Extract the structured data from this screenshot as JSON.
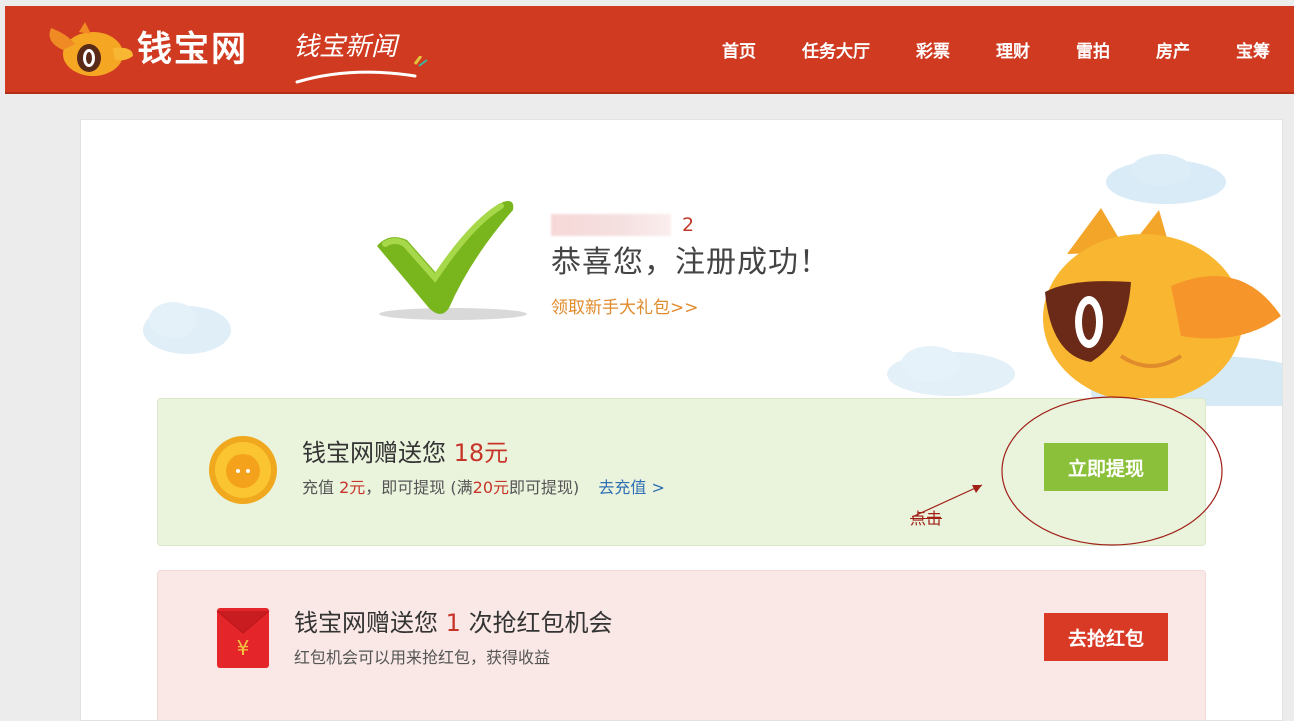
{
  "header": {
    "brand": "钱宝网",
    "news_brand": "钱宝新闻",
    "nav": [
      "首页",
      "任务大厅",
      "彩票",
      "理财",
      "雷拍",
      "房产",
      "宝筹"
    ],
    "bg_color": "#cf3a20"
  },
  "success": {
    "phone_suffix": "2",
    "message": "恭喜您，注册成功！",
    "gift_link": "领取新手大礼包>>"
  },
  "reward": {
    "title_prefix": "钱宝网赠送您",
    "amount": "18元",
    "sub_1": "充值",
    "sub_amount": "2元",
    "sub_2": "，即可提现 (满",
    "sub_threshold": "20元",
    "sub_3": "即可提现)",
    "recharge_link": "去充值 >",
    "button": "立即提现",
    "annotation": "点击",
    "accent_color": "#c7352a",
    "button_color": "#8bc13a"
  },
  "redpacket": {
    "title_prefix": "钱宝网赠送您",
    "count": "1",
    "title_suffix": "次抢红包机会",
    "subtitle": "红包机会可以用来抢红包，获得收益",
    "button": "去抢红包",
    "button_color": "#d93a26"
  }
}
